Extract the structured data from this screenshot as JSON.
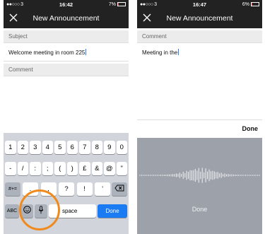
{
  "left_screen": {
    "status": {
      "carrier": "●●○○○ 3",
      "time": "16:42",
      "battery_text": "7%",
      "battery_fraction": 0.07
    },
    "nav": {
      "title": "New Announcement"
    },
    "subject": {
      "label": "Subject",
      "value": "Welcome meeting in room 225"
    },
    "comment": {
      "label": "Comment",
      "value": ""
    },
    "keyboard": {
      "row1": [
        "1",
        "2",
        "3",
        "4",
        "5",
        "6",
        "7",
        "8",
        "9",
        "0"
      ],
      "row2": [
        "-",
        "/",
        ":",
        ";",
        "(",
        ")",
        "£",
        "&",
        "@",
        "”"
      ],
      "shift_label": "#+=",
      "row3": [
        ".",
        ",",
        "?",
        "!",
        "’"
      ],
      "abc_label": "ABC",
      "space_label": "space",
      "done_label": "Done"
    }
  },
  "right_screen": {
    "status": {
      "carrier": "●●○○○ 3",
      "time": "16:47",
      "battery_text": "6%",
      "battery_fraction": 0.06
    },
    "nav": {
      "title": "New Announcement"
    },
    "comment": {
      "label": "Comment",
      "value": "Meeting in the"
    },
    "toolbar": {
      "done_label": "Done"
    },
    "dictation": {
      "done_label": "Done"
    }
  },
  "colors": {
    "navbar": "#222222",
    "keyboard_bg": "#d1d4da",
    "done_key": "#1a7bf2",
    "highlight": "#f08a1c",
    "dictation_bg": "#9da2aa"
  }
}
